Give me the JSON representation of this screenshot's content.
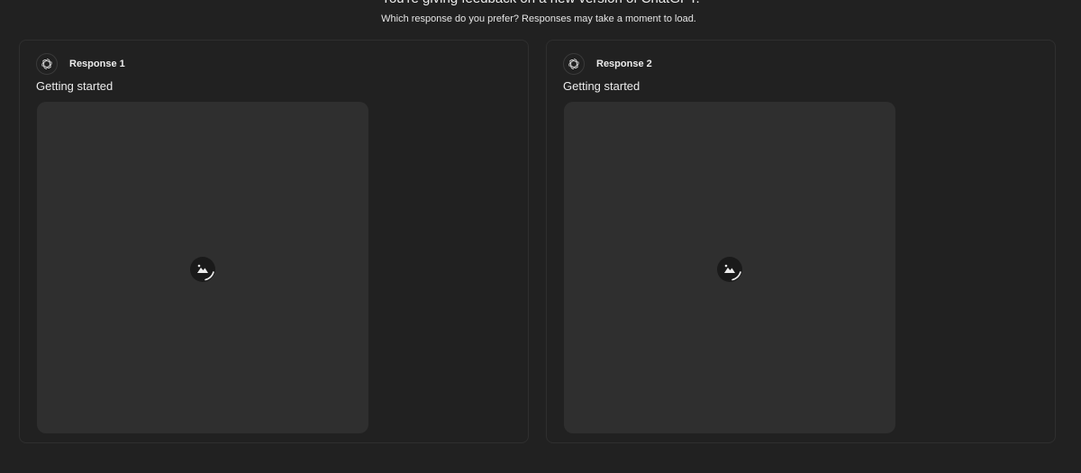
{
  "header": {
    "title": "You're giving feedback on a new version of ChatGPT.",
    "subtitle": "Which response do you prefer? Responses may take a moment to load."
  },
  "responses": [
    {
      "label": "Response 1",
      "status": "Getting started",
      "avatar_icon": "openai-logo-icon",
      "loader_icon": "image-loading-icon"
    },
    {
      "label": "Response 2",
      "status": "Getting started",
      "avatar_icon": "openai-logo-icon",
      "loader_icon": "image-loading-icon"
    }
  ],
  "colors": {
    "background": "#212121",
    "panel_border": "#2f2f2f",
    "image_placeholder": "#2f2f2f",
    "text": "#ececec"
  }
}
